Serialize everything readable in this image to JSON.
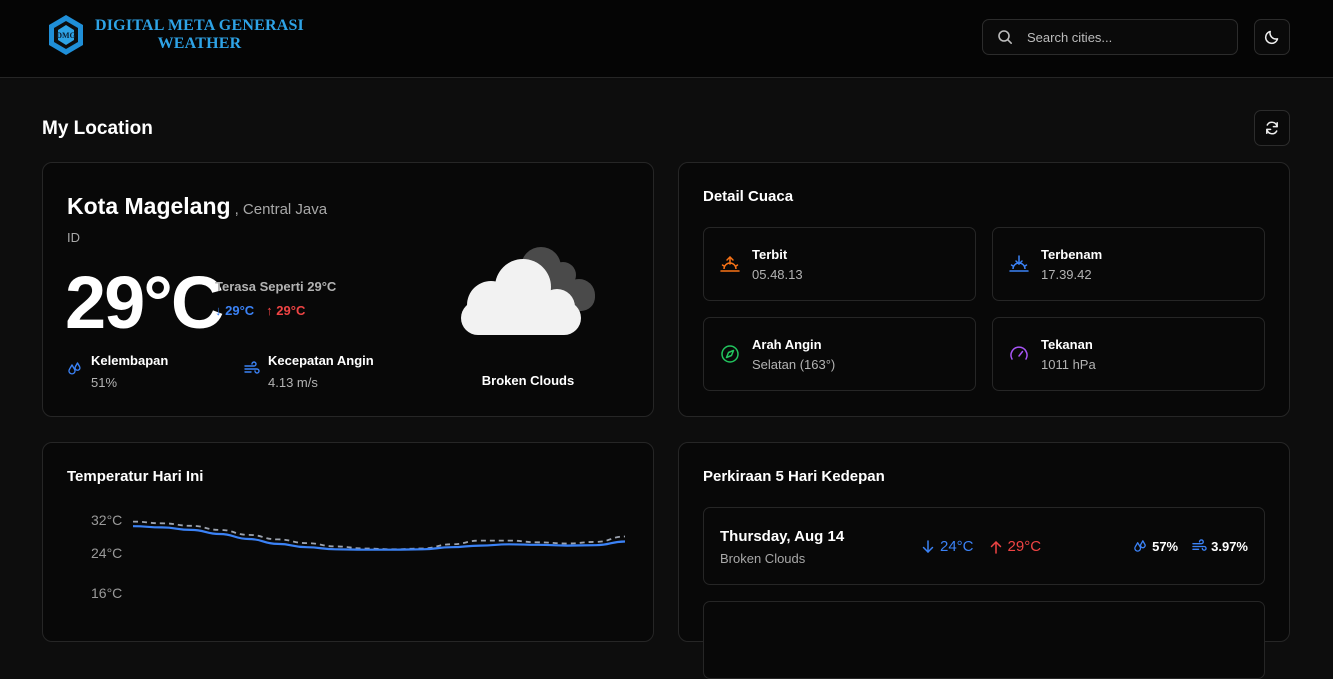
{
  "app": {
    "logo_badge": "DMG",
    "logo_line1": "DIGITAL META GENERASI",
    "logo_line2": "WEATHER"
  },
  "search": {
    "placeholder": "Search cities..."
  },
  "page": {
    "title": "My Location"
  },
  "current": {
    "city": "Kota Magelang",
    "region": ", Central Java",
    "country": "ID",
    "temp": "29°C",
    "feels_like": "Terasa Seperti 29°C",
    "min": "29°C",
    "max": "29°C",
    "humidity_label": "Kelembapan",
    "humidity": "51%",
    "wind_label": "Kecepatan Angin",
    "wind": "4.13 m/s",
    "condition": "Broken Clouds",
    "icon": "broken-clouds-icon"
  },
  "details": {
    "title": "Detail Cuaca",
    "sunrise_label": "Terbit",
    "sunrise": "05.48.13",
    "sunset_label": "Terbenam",
    "sunset": "17.39.42",
    "wind_dir_label": "Arah Angin",
    "wind_dir": "Selatan (163°)",
    "pressure_label": "Tekanan",
    "pressure": "1011 hPa"
  },
  "today_chart": {
    "title": "Temperatur Hari Ini",
    "y_ticks": [
      "32°C",
      "24°C",
      "16°C"
    ],
    "series_colors": {
      "temp": "#3b82f6",
      "feels": "#9ca3af"
    },
    "temp": [
      30.5,
      30.2,
      29.6,
      28.6,
      27.4,
      26.2,
      25.4,
      24.9,
      24.8,
      24.8,
      24.9,
      25.4,
      25.8,
      26.1,
      26.0,
      25.8,
      25.9,
      26.8
    ],
    "feels_like": [
      31.6,
      31.2,
      30.6,
      29.6,
      28.4,
      27.3,
      26.4,
      25.6,
      25.1,
      24.9,
      25.1,
      26.1,
      27.0,
      27.0,
      26.6,
      26.3,
      26.7,
      28.0
    ]
  },
  "forecast": {
    "title": "Perkiraan 5 Hari Kedepan",
    "days": [
      {
        "day": "Thursday, Aug 14",
        "condition": "Broken Clouds",
        "min": "24°C",
        "max": "29°C",
        "humidity": "57%",
        "wind": "3.97%"
      }
    ]
  },
  "colors": {
    "accent_blue": "#3b82f6",
    "accent_red": "#ef4444",
    "sunrise_orange": "#f97316",
    "wind_green": "#22c55e",
    "pressure_purple": "#a855f7",
    "logo_blue": "#2ea3e6"
  }
}
